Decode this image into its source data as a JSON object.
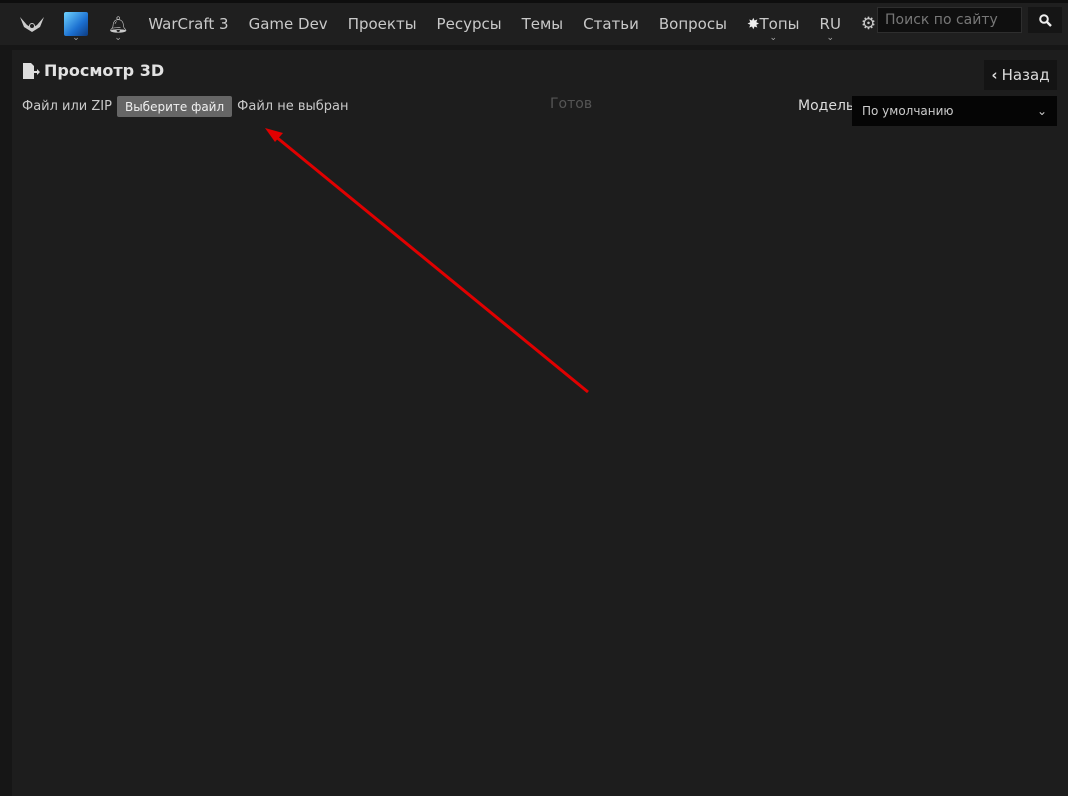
{
  "nav": {
    "items": [
      "WarCraft 3",
      "Game Dev",
      "Проекты",
      "Ресурсы",
      "Темы",
      "Статьи",
      "Вопросы",
      "Топы",
      "RU"
    ],
    "search_placeholder": "Поиск по сайту"
  },
  "page": {
    "title": "Просмотр 3D",
    "back_label": "Назад",
    "file_label": "Файл или ZIP",
    "file_button": "Выберите файл",
    "file_status": "Файл не выбран",
    "status": "Готов",
    "model_label": "Модель",
    "model_value": "По умолчанию"
  },
  "colors": {
    "annotation_arrow": "#e00000"
  }
}
